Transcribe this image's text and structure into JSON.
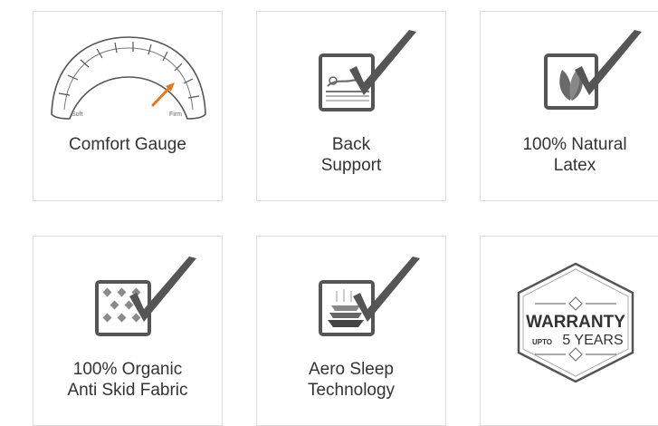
{
  "features": [
    {
      "title": "Comfort Gauge",
      "lines": [
        "Comfort Gauge"
      ],
      "icon": "comfort-gauge-icon",
      "gauge_soft": "Soft",
      "gauge_firm": "Firm"
    },
    {
      "title": "Back Support",
      "lines": [
        "Back",
        "Support"
      ],
      "icon": "back-support-icon"
    },
    {
      "title": "100% Natural Latex",
      "lines": [
        "100% Natural",
        "Latex"
      ],
      "icon": "natural-latex-icon"
    },
    {
      "title": "100% Organic Anti Skid Fabric",
      "lines": [
        "100% Organic",
        "Anti Skid Fabric"
      ],
      "icon": "anti-skid-fabric-icon"
    },
    {
      "title": "Aero Sleep Technology",
      "lines": [
        "Aero Sleep",
        "Technology"
      ],
      "icon": "aero-sleep-icon"
    },
    {
      "title": "Warranty upto 5 years",
      "lines": [],
      "icon": "warranty-badge-icon",
      "badge_word": "WARRANTY",
      "badge_upto": "UPTO",
      "badge_years": "5 YEARS"
    }
  ],
  "colors": {
    "icon_gray": "#5a5a5a",
    "accent_orange": "#e8761e",
    "border": "#dcdcdc"
  }
}
